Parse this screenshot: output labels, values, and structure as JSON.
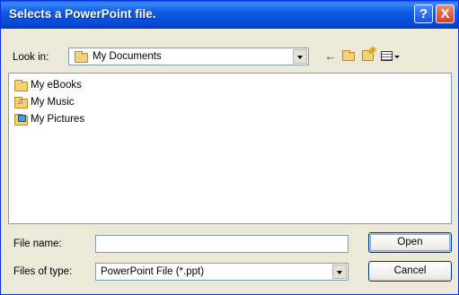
{
  "window": {
    "title": "Selects a PowerPoint file.",
    "help_label": "?",
    "close_label": "X"
  },
  "lookin": {
    "label": "Look in:",
    "value": "My Documents",
    "icons": [
      "back-arrow-icon",
      "up-folder-icon",
      "new-folder-icon",
      "view-menu-icon"
    ]
  },
  "list": {
    "items": [
      {
        "label": "My eBooks",
        "icon": "folder-icon"
      },
      {
        "label": "My Music",
        "icon": "music-folder-icon"
      },
      {
        "label": "My Pictures",
        "icon": "pictures-folder-icon"
      }
    ]
  },
  "filename": {
    "label": "File name:",
    "value": ""
  },
  "filetype": {
    "label": "Files of type:",
    "value": "PowerPoint File (*.ppt)"
  },
  "buttons": {
    "open": "Open",
    "cancel": "Cancel"
  },
  "colors": {
    "titlebar": "#0a5fe8",
    "dialog_bg": "#ece9d8",
    "border": "#7f9db9"
  }
}
